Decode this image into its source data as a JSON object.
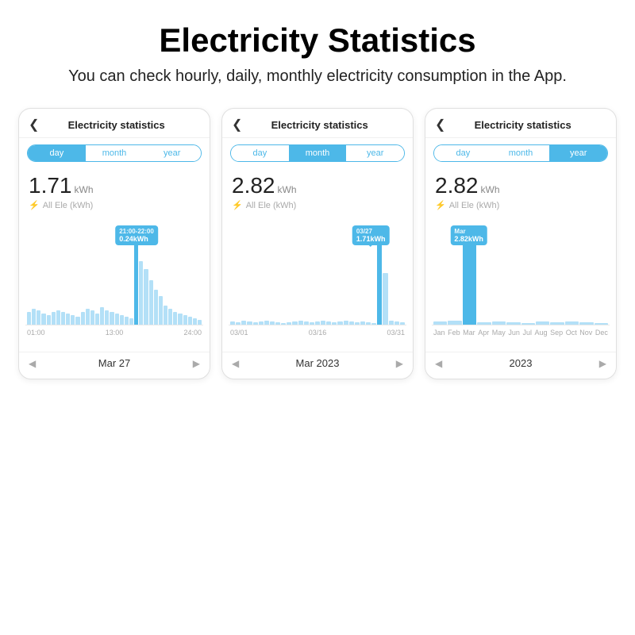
{
  "header": {
    "title": "Electricity Statistics",
    "subtitle": "You can check hourly, daily, monthly electricity consumption in the App."
  },
  "phones": [
    {
      "id": "phone-day",
      "title": "Electricity statistics",
      "tabs": [
        "day",
        "month",
        "year"
      ],
      "active_tab": 0,
      "kwh_value": "1.71",
      "kwh_unit": "kWh",
      "ele_label": "All Ele (kWh)",
      "tooltip": "0.24kWh",
      "tooltip_sub": "21:00-22:00",
      "x_labels": [
        "01:00",
        "13:00",
        "24:00"
      ],
      "nav_label": "Mar 27",
      "bars": [
        8,
        10,
        9,
        7,
        6,
        8,
        9,
        8,
        7,
        6,
        5,
        8,
        10,
        9,
        7,
        11,
        9,
        8,
        7,
        6,
        5,
        4,
        60,
        40,
        35,
        28,
        22,
        18,
        12,
        10,
        8,
        7,
        6,
        5,
        4,
        3
      ]
    },
    {
      "id": "phone-month",
      "title": "Electricity statistics",
      "tabs": [
        "day",
        "month",
        "year"
      ],
      "active_tab": 1,
      "kwh_value": "2.82",
      "kwh_unit": "kWh",
      "ele_label": "All Ele (kWh)",
      "tooltip": "1.71kWh",
      "tooltip_sub": "03/27",
      "x_labels": [
        "03/01",
        "03/16",
        "03/31"
      ],
      "nav_label": "Mar 2023",
      "bars": [
        4,
        3,
        5,
        4,
        3,
        4,
        5,
        4,
        3,
        2,
        3,
        4,
        5,
        4,
        3,
        4,
        5,
        4,
        3,
        4,
        5,
        4,
        3,
        4,
        3,
        2,
        110,
        60,
        5,
        4,
        3
      ]
    },
    {
      "id": "phone-year",
      "title": "Electricity statistics",
      "tabs": [
        "day",
        "month",
        "year"
      ],
      "active_tab": 2,
      "kwh_value": "2.82",
      "kwh_unit": "kWh",
      "ele_label": "All Ele (kWh)",
      "tooltip": "2.82kWh",
      "tooltip_sub": "Mar",
      "x_labels": [
        "Jan",
        "Feb",
        "Mar",
        "Apr",
        "May",
        "Jun",
        "Jul",
        "Aug",
        "Sep",
        "Oct",
        "Nov",
        "Dec"
      ],
      "nav_label": "2023",
      "bars": [
        4,
        5,
        120,
        3,
        4,
        3,
        2,
        4,
        3,
        4,
        3,
        2
      ]
    }
  ]
}
